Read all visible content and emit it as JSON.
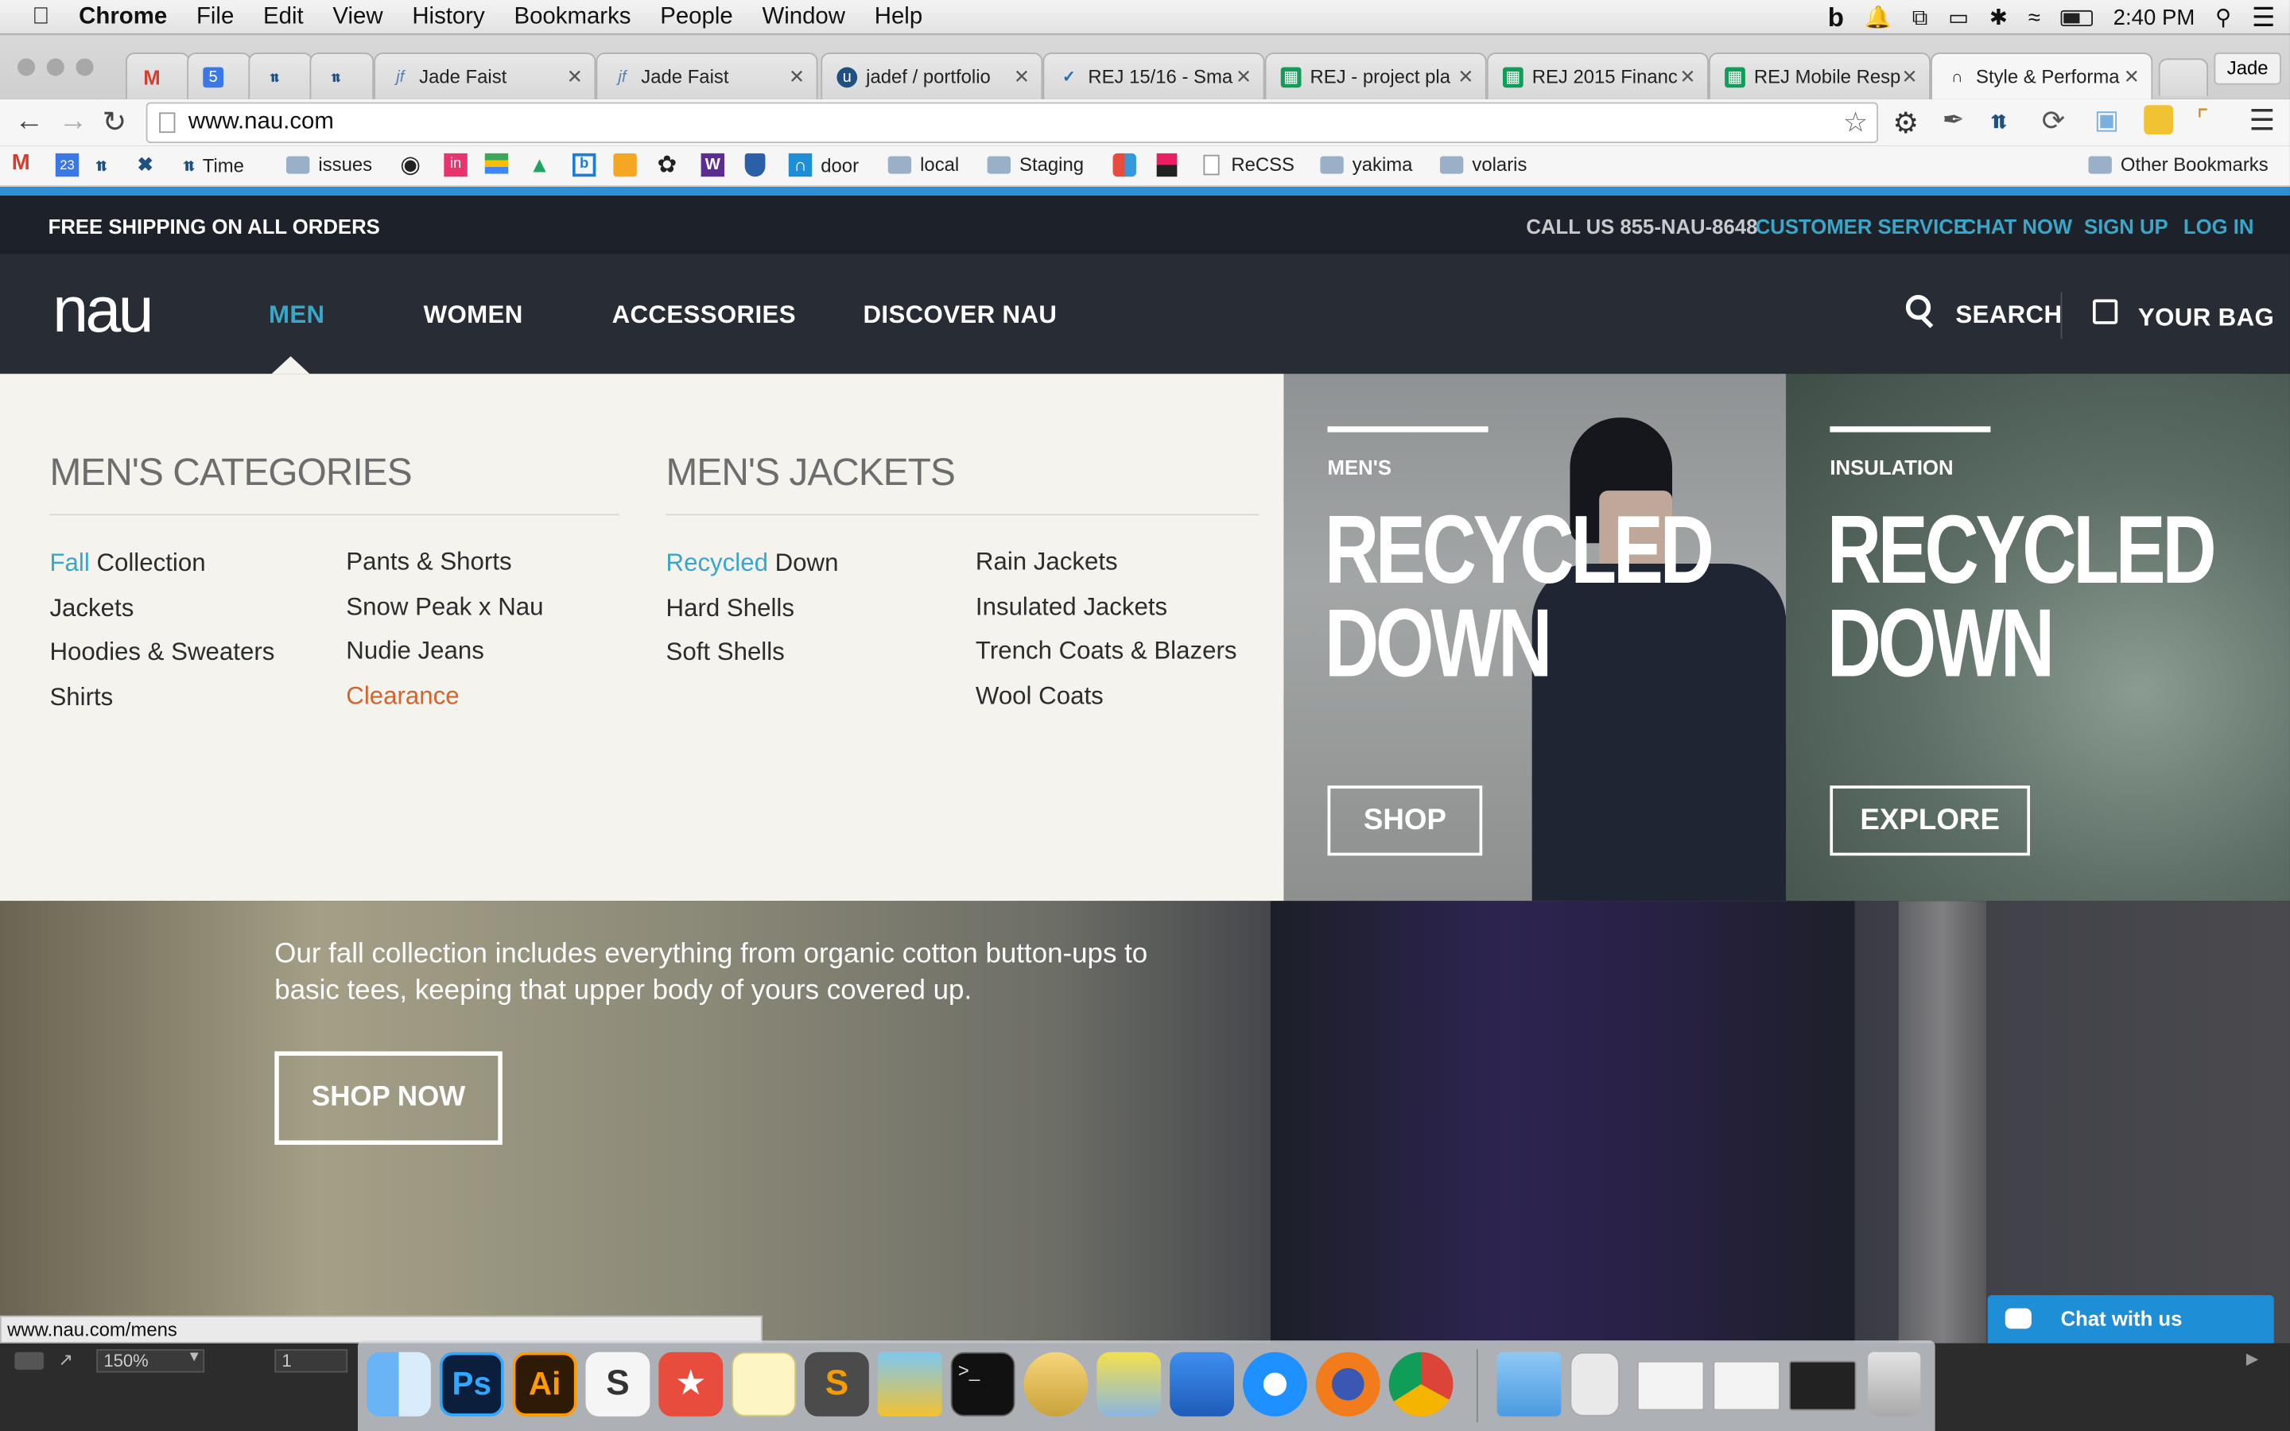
{
  "menubar": {
    "app": "Chrome",
    "items": [
      "File",
      "Edit",
      "View",
      "History",
      "Bookmarks",
      "People",
      "Window",
      "Help"
    ],
    "time": "2:40 PM"
  },
  "tabs": [
    {
      "label": "Jade Faist"
    },
    {
      "label": "Jade Faist"
    },
    {
      "label": "jadef / portfolio"
    },
    {
      "label": "REJ 15/16 - Sma"
    },
    {
      "label": "REJ - project pla"
    },
    {
      "label": "REJ 2015 Financ"
    },
    {
      "label": "REJ Mobile Resp"
    },
    {
      "label": "Style & Performa"
    }
  ],
  "profile": "Jade",
  "calendar_badge": "5",
  "address": "www.nau.com",
  "bookmarks": {
    "cal_badge": "23",
    "time": "Time",
    "issues": "issues",
    "door": "door",
    "local": "local",
    "staging": "Staging",
    "recss": "ReCSS",
    "yakima": "yakima",
    "volaris": "volaris",
    "other": "Other Bookmarks"
  },
  "site": {
    "shipping": "FREE SHIPPING ON ALL ORDERS",
    "call": "CALL US 855-NAU-8648",
    "customer_service": "CUSTOMER SERVICE",
    "chat_now": "CHAT NOW",
    "sign_up": "SIGN UP",
    "log_in": "LOG IN",
    "logo": "nau",
    "nav": {
      "men": "MEN",
      "women": "WOMEN",
      "accessories": "ACCESSORIES",
      "discover": "DISCOVER NAU"
    },
    "search": "SEARCH",
    "bag": "YOUR BAG"
  },
  "megamenu": {
    "cat_heading": "MEN'S CATEGORIES",
    "jackets_heading": "MEN'S JACKETS",
    "cat_col1": {
      "fall_hl": "Fall",
      "fall_rest": " Collection",
      "jackets": "Jackets",
      "hoodies": "Hoodies & Sweaters",
      "shirts": "Shirts"
    },
    "cat_col2": [
      "Pants & Shorts",
      "Snow Peak x Nau",
      "Nudie Jeans",
      "Clearance"
    ],
    "jk_col1": {
      "recycled_hl": "Recycled",
      "recycled_rest": " Down",
      "hard": "Hard Shells",
      "soft": "Soft Shells"
    },
    "jk_col2": [
      "Rain Jackets",
      "Insulated Jackets",
      "Trench Coats & Blazers",
      "Wool Coats"
    ]
  },
  "promos": [
    {
      "kicker": "MEN'S",
      "line1": "RECYCLED",
      "line2": "DOWN",
      "button": "SHOP"
    },
    {
      "kicker": "INSULATION",
      "line1": "RECYCLED",
      "line2": "DOWN",
      "button": "EXPLORE"
    }
  ],
  "hero": {
    "text": "Our fall collection includes everything from organic cotton button-ups to basic tees, keeping that upper body of yours covered up.",
    "button": "SHOP NOW"
  },
  "chat_widget": "Chat with us",
  "status_url": "www.nau.com/mens",
  "zoom": "150%",
  "page_num": "1",
  "colors": {
    "accent": "#3aa6c8",
    "clearance": "#d0652e",
    "chrome_blue": "#2d8fd6"
  }
}
